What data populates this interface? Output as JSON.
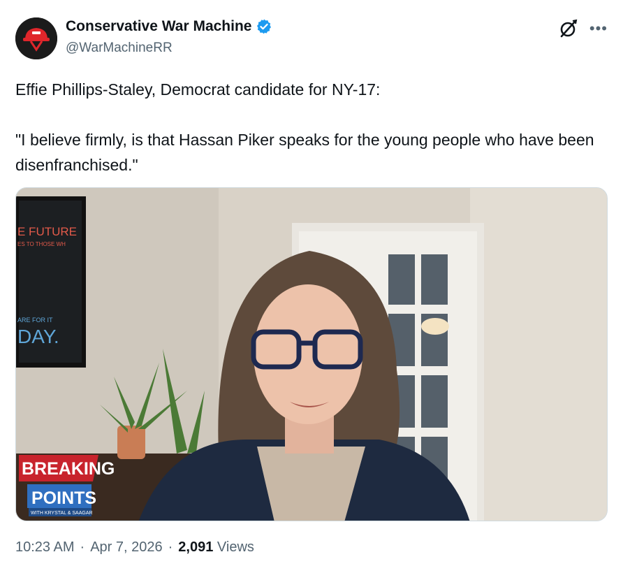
{
  "author": {
    "name": "Conservative War Machine",
    "handle": "@WarMachineRR",
    "verified": true,
    "avatar_icon": "helmet-icon"
  },
  "tweet": {
    "line1": "Effie Phillips-Staley, Democrat candidate for NY-17:",
    "line2": "\"I believe firmly, is that Hassan Piker speaks for the young people who have been disenfranchised.\""
  },
  "media": {
    "poster_text_top": "E FUTURE",
    "poster_text_sub": "ES TO THOSE WH",
    "poster_text_mid": "ARE FOR IT",
    "poster_text_bottom": "DAY.",
    "logo_breaking": "BREAKING",
    "logo_points": "POINTS",
    "logo_sub": "WITH KRYSTAL & SAAGAR"
  },
  "meta": {
    "time": "10:23 AM",
    "date": "Apr 7, 2026",
    "views_count": "2,091",
    "views_label": "Views",
    "separator": "·"
  },
  "colors": {
    "verified": "#1d9bf0",
    "breaking_red": "#c8232c",
    "points_blue": "#2f6fc0"
  }
}
